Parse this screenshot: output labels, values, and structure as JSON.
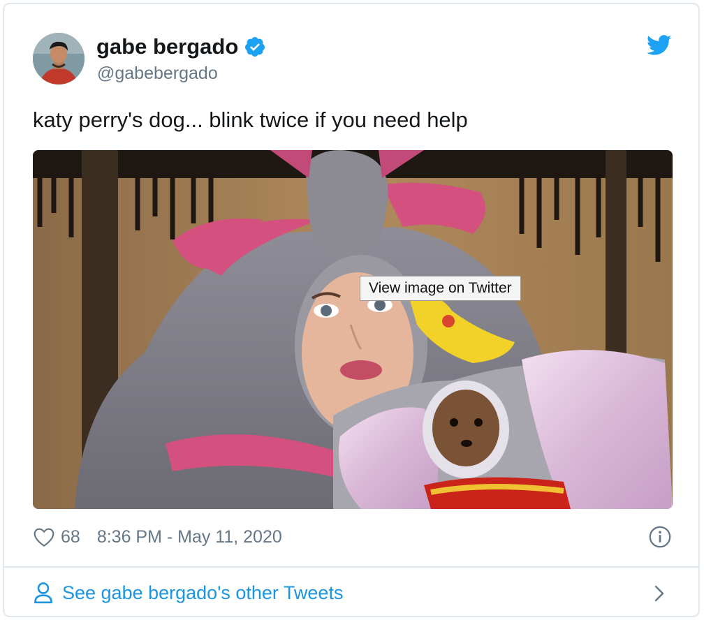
{
  "author": {
    "name": "gabe bergado",
    "handle": "@gabebergado",
    "verified_icon": "verified-badge-icon",
    "avatar_icon": "avatar"
  },
  "tweet": {
    "text": "katy perry's dog... blink twice if you need help",
    "media_tooltip": "View image on Twitter",
    "likes": "68",
    "timestamp": "8:36 PM - May 11, 2020"
  },
  "footer": {
    "link_text": "See gabe bergado's other Tweets"
  },
  "icons": {
    "brand": "twitter-bird-icon",
    "like": "heart-icon",
    "info": "info-icon",
    "person": "person-icon",
    "chevron": "chevron-right-icon"
  },
  "colors": {
    "twitter_blue": "#1da1f2",
    "link_blue": "#1b95e0",
    "secondary_text": "#657786",
    "border": "#e1e8ed"
  }
}
